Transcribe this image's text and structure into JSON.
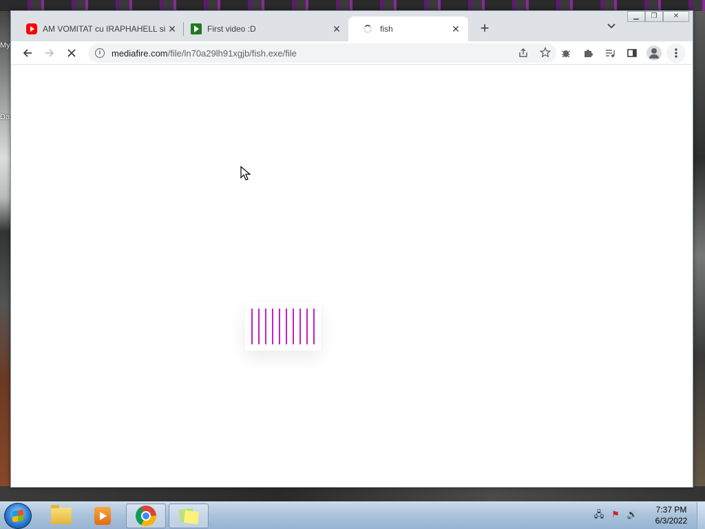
{
  "desktop": {
    "labels": [
      "My",
      "Da"
    ]
  },
  "browser": {
    "tabs": [
      {
        "title": "AM VOMITAT cu IRAPHAHELL si ...",
        "favicon": "youtube-icon",
        "active": false
      },
      {
        "title": "First video :D",
        "favicon": "rumble-icon",
        "active": false
      },
      {
        "title": "fish",
        "favicon": "loading-spinner-icon",
        "active": true
      }
    ],
    "new_tab_glyph": "+",
    "tab_search_glyph": "⌄",
    "window_controls": {
      "minimize": "▁",
      "restore": "❐",
      "close": "✕"
    },
    "toolbar": {
      "back_glyph": "←",
      "forward_glyph": "→",
      "stop_glyph": "✕",
      "url_host": "mediafire.com",
      "url_path": "/file/ln70a29lh91xgjb/fish.exe/file"
    }
  },
  "page": {
    "loader_bar_count": 10,
    "accent_color": "#c71cc7"
  },
  "taskbar": {
    "apps": [
      "windows-explorer",
      "media-player",
      "google-chrome",
      "sticky-notes"
    ],
    "clock": {
      "time": "7:37 PM",
      "date": "6/3/2022"
    }
  }
}
